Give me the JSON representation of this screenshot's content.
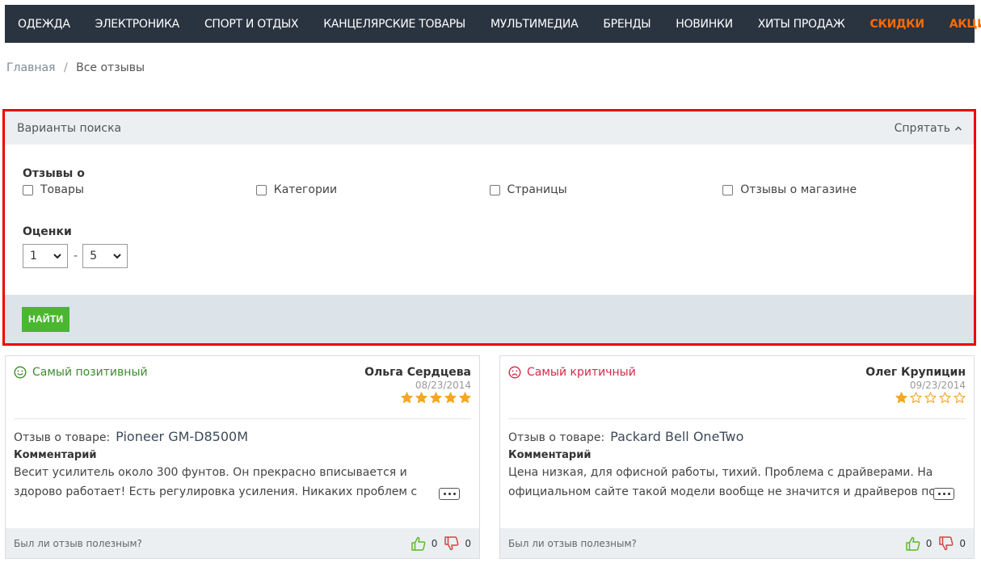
{
  "nav": {
    "items": [
      {
        "label": "ОДЕЖДА",
        "accent": false
      },
      {
        "label": "ЭЛЕКТРОНИКА",
        "accent": false
      },
      {
        "label": "СПОРТ И ОТДЫХ",
        "accent": false
      },
      {
        "label": "КАНЦЕЛЯРСКИЕ ТОВАРЫ",
        "accent": false
      },
      {
        "label": "МУЛЬТИМЕДИА",
        "accent": false
      },
      {
        "label": "БРЕНДЫ",
        "accent": false
      },
      {
        "label": "НОВИНКИ",
        "accent": false
      },
      {
        "label": "ХИТЫ ПРОДАЖ",
        "accent": false
      },
      {
        "label": "СКИДКИ",
        "accent": true
      },
      {
        "label": "АКЦИИ",
        "accent": true
      }
    ],
    "accent_color": "#ff6a00"
  },
  "breadcrumb": {
    "home": "Главная",
    "separator": "/",
    "current": "Все отзывы"
  },
  "search": {
    "title": "Варианты поиска",
    "hide_label": "Спрятать",
    "reviews_about_title": "Отзывы о",
    "options": [
      "Товары",
      "Категории",
      "Страницы",
      "Отзывы о магазине"
    ],
    "ratings_title": "Оценки",
    "rating_from": "1",
    "rating_dash": "-",
    "rating_to": "5",
    "find_label": "НАЙТИ"
  },
  "reviews": [
    {
      "badge": "Самый позитивный",
      "badge_color": "#3c8c2c",
      "author": "Ольга Сердцева",
      "date": "08/23/2014",
      "rating": 5,
      "about_label": "Отзыв о товаре:",
      "product": "Pioneer GM-D8500M",
      "comment_label": "Комментарий",
      "comment": "Весит усилитель около 300 фунтов. Он прекрасно вписывается и здорово работает! Есть регулировка усиления. Никаких проблем с усилителем у меня",
      "useful_question": "Был ли отзыв полезным?",
      "likes": "0",
      "dislikes": "0"
    },
    {
      "badge": "Самый критичный",
      "badge_color": "#d6284a",
      "author": "Олег Крупицин",
      "date": "09/23/2014",
      "rating": 1,
      "about_label": "Отзыв о товаре:",
      "product": "Packard Bell OneTwo",
      "comment_label": "Комментарий",
      "comment": "Цена низкая, для офисной работы, тихий. Проблема с драйверами. На официальном сайте такой модели вообще не значится и драйверов под",
      "useful_question": "Был ли отзыв полезным?",
      "likes": "0",
      "dislikes": "0"
    }
  ],
  "colors": {
    "nav_bg": "#2a3340",
    "find_button": "#4ab731",
    "star": "#f5a623",
    "highlight_border": "#ee0000"
  }
}
